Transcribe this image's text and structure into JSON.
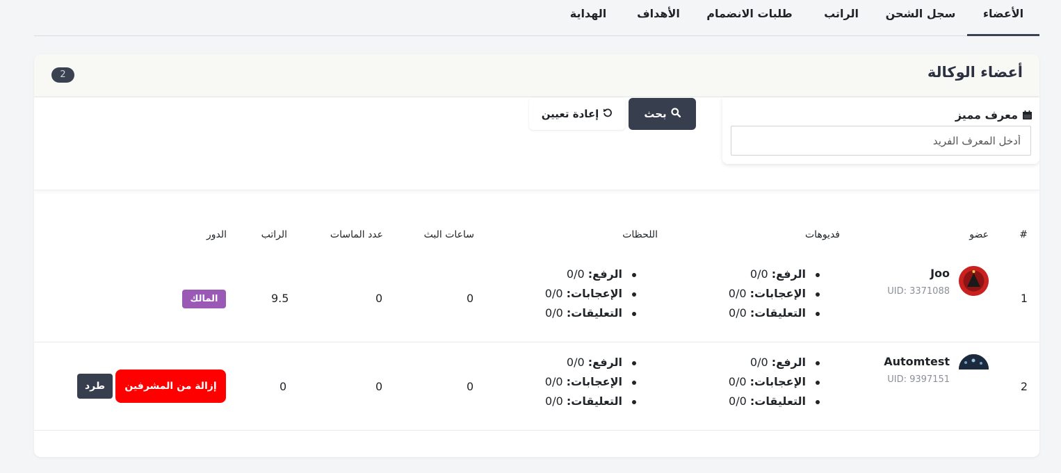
{
  "tabs": [
    {
      "label": "الأعضاء",
      "active": true
    },
    {
      "label": "سجل الشحن"
    },
    {
      "label": "الراتب"
    },
    {
      "label": "طلبات الانضمام"
    },
    {
      "label": "الأهداف"
    },
    {
      "label": "الهداية"
    }
  ],
  "card": {
    "title": "أعضاء الوكالة",
    "count": "2"
  },
  "filter": {
    "label": "معرف مميز",
    "placeholder": "أدخل المعرف الفريد",
    "search_label": "بحث",
    "reset_label": "إعادة تعيين"
  },
  "table": {
    "headers": {
      "index": "#",
      "member": "عضو",
      "videos": "فديوهات",
      "moments": "اللحظات",
      "live_hours": "ساعات البث",
      "diamonds": "عدد الماسات",
      "salary": "الراتب",
      "role": "الدور"
    },
    "rows": [
      {
        "index": "1",
        "name": "Joo",
        "uid": "UID: 3371088",
        "videos": {
          "upload_label": "الرفع:",
          "upload": "0/0",
          "likes_label": "الإعجابات:",
          "likes": "0/0",
          "comments_label": "التعليقات:",
          "comments": "0/0"
        },
        "moments": {
          "upload_label": "الرفع:",
          "upload": "0/0",
          "likes_label": "الإعجابات:",
          "likes": "0/0",
          "comments_label": "التعليقات:",
          "comments": "0/0"
        },
        "live_hours": "0",
        "diamonds": "0",
        "salary": "9.5",
        "role": "المالك"
      },
      {
        "index": "2",
        "name": "Automtest",
        "uid": "UID: 9397151",
        "videos": {
          "upload_label": "الرفع:",
          "upload": "0/0",
          "likes_label": "الإعجابات:",
          "likes": "0/0",
          "comments_label": "التعليقات:",
          "comments": "0/0"
        },
        "moments": {
          "upload_label": "الرفع:",
          "upload": "0/0",
          "likes_label": "الإعجابات:",
          "likes": "0/0",
          "comments_label": "التعليقات:",
          "comments": "0/0"
        },
        "live_hours": "0",
        "diamonds": "0",
        "salary": "0",
        "remove_label": "إزالة من المشرفين",
        "kick_label": "طرد"
      }
    ]
  },
  "colors": {
    "owner_badge": "#9b59b6",
    "remove_button": "#ff0000",
    "dark_button": "#373e4d"
  }
}
